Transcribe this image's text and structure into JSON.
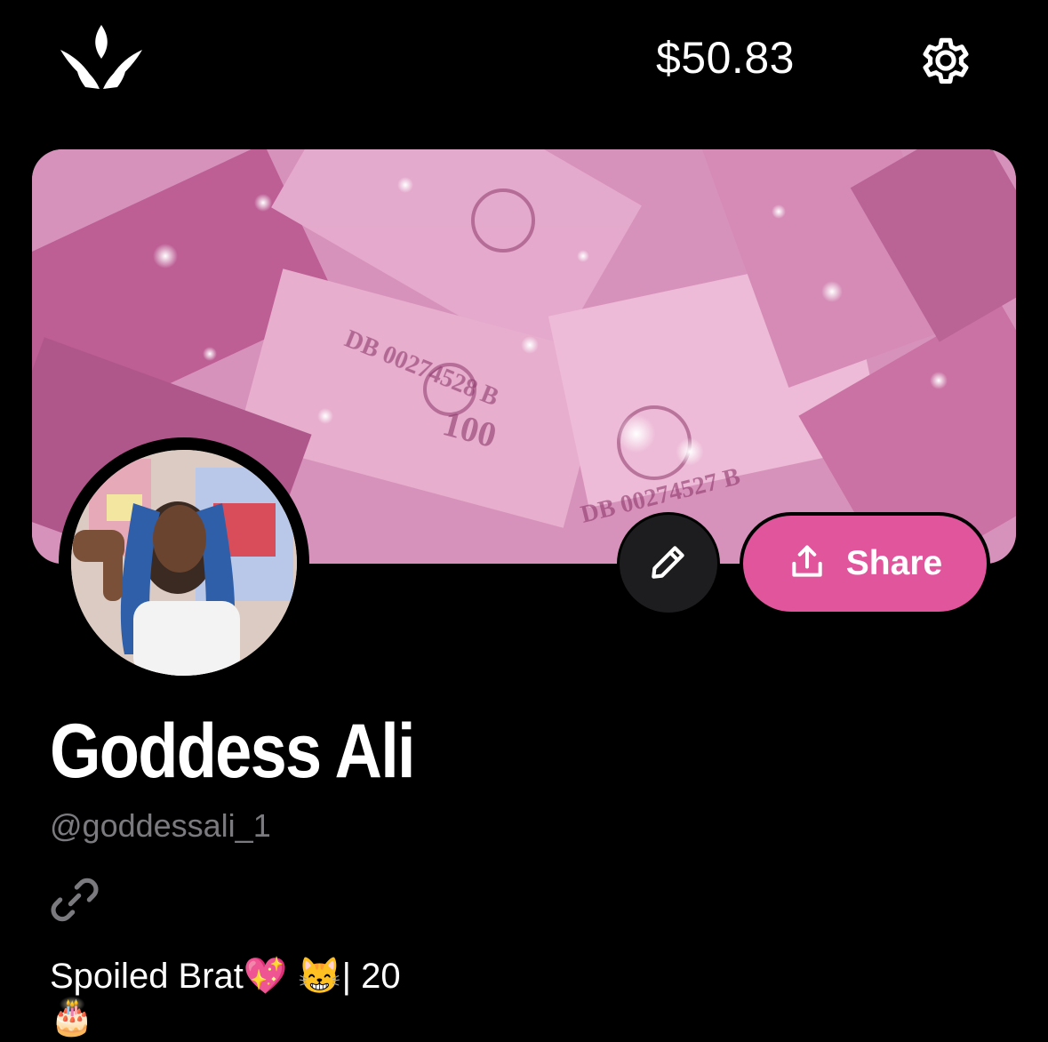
{
  "header": {
    "logo_icon": "crown-logo-icon",
    "balance": "$50.83",
    "settings_icon": "gear-icon"
  },
  "profile": {
    "banner_description_icon": "glitter-money-banner",
    "edit_icon": "pencil-icon",
    "share_icon": "share-upload-icon",
    "share_label": "Share",
    "name": "Goddess Ali",
    "handle": "@goddessali_1",
    "link_icon": "link-icon",
    "bio_line1": "Spoiled Brat💖 😸| 20",
    "bio_line2": "🎂"
  },
  "colors": {
    "background": "#000000",
    "accent_pink": "#e0559c",
    "handle_gray": "#7b7b7f",
    "edit_button_bg": "#1d1d1f"
  }
}
